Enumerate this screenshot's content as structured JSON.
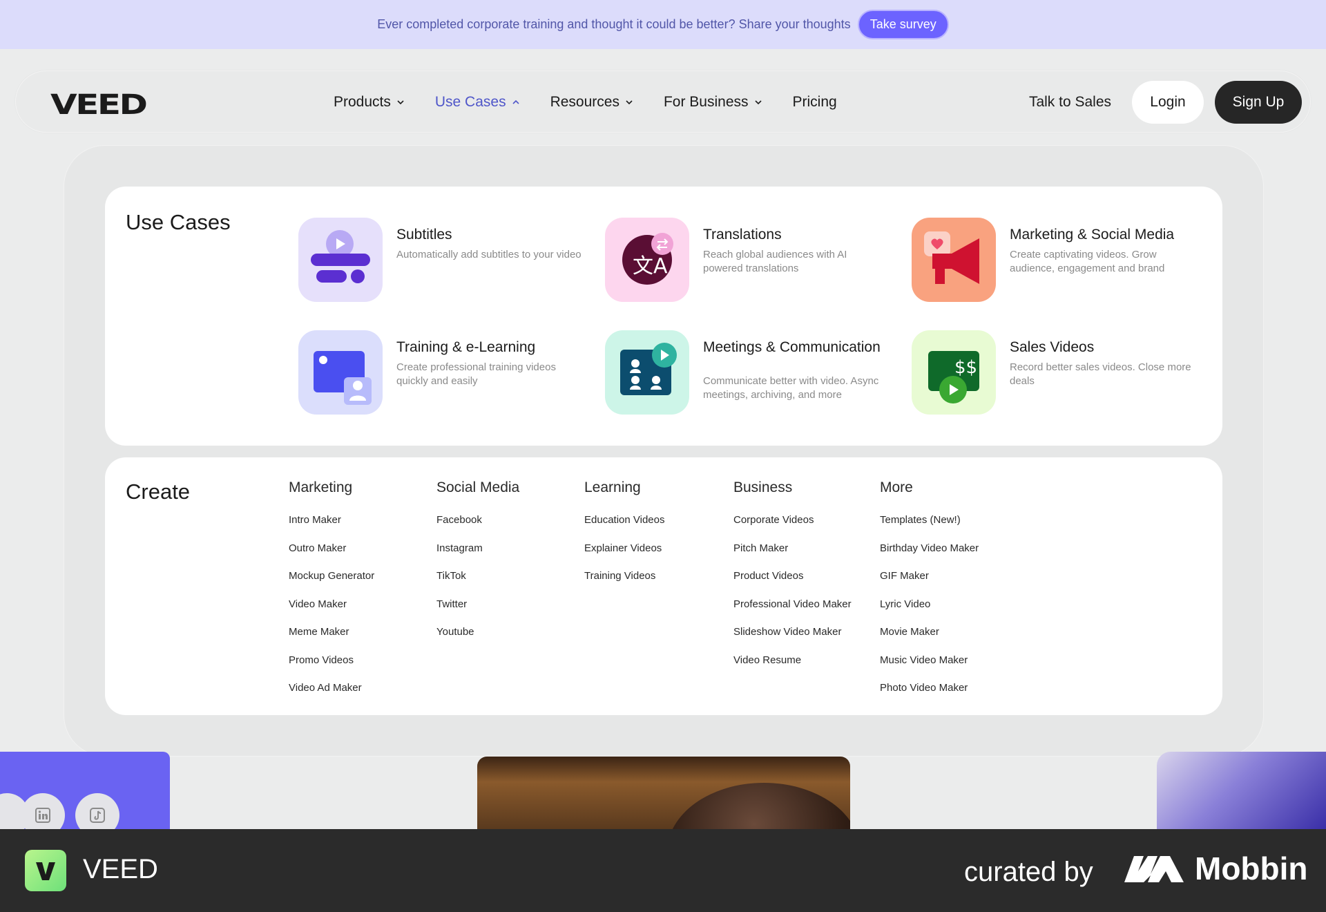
{
  "banner": {
    "text": "Ever completed corporate training and thought it could be better? Share your thoughts",
    "button": "Take survey"
  },
  "nav": {
    "logo": "VEED",
    "items": [
      {
        "label": "Products",
        "has_chevron": true,
        "active": false
      },
      {
        "label": "Use Cases",
        "has_chevron": true,
        "active": true
      },
      {
        "label": "Resources",
        "has_chevron": true,
        "active": false
      },
      {
        "label": "For Business",
        "has_chevron": true,
        "active": false
      },
      {
        "label": "Pricing",
        "has_chevron": false,
        "active": false
      }
    ],
    "talk_to_sales": "Talk to Sales",
    "login": "Login",
    "signup": "Sign Up"
  },
  "use_cases": {
    "title": "Use Cases",
    "items": [
      {
        "name": "Subtitles",
        "desc": "Automatically add subtitles to your video",
        "icon": "subtitles-icon"
      },
      {
        "name": "Translations",
        "desc": "Reach global audiences with AI powered translations",
        "icon": "translate-icon"
      },
      {
        "name": "Marketing & Social Media",
        "desc": "Create captivating videos. Grow audience, engagement and brand",
        "icon": "megaphone-icon"
      },
      {
        "name": "Training & e-Learning",
        "desc": "Create professional training videos quickly and easily",
        "icon": "presentation-icon"
      },
      {
        "name": "Meetings & Communication",
        "desc": "Communicate better with video. Async meetings, archiving, and more",
        "icon": "meeting-icon"
      },
      {
        "name": "Sales Videos",
        "desc": "Record better sales videos. Close more deals",
        "icon": "money-icon"
      }
    ]
  },
  "create": {
    "title": "Create",
    "columns": [
      {
        "heading": "Marketing",
        "links": [
          "Intro Maker",
          "Outro Maker",
          "Mockup Generator",
          "Video Maker",
          "Meme Maker",
          "Promo Videos",
          "Video Ad Maker"
        ]
      },
      {
        "heading": "Social Media",
        "links": [
          "Facebook",
          "Instagram",
          "TikTok",
          "Twitter",
          "Youtube"
        ]
      },
      {
        "heading": "Learning",
        "links": [
          "Education Videos",
          "Explainer Videos",
          "Training Videos"
        ]
      },
      {
        "heading": "Business",
        "links": [
          "Corporate Videos",
          "Pitch Maker",
          "Product Videos",
          "Professional Video Maker",
          "Slideshow Video Maker",
          "Video Resume"
        ]
      },
      {
        "heading": "More",
        "links": [
          "Templates (New!)",
          "Birthday Video Maker",
          "GIF Maker",
          "Lyric Video",
          "Movie Maker",
          "Music Video Maker",
          "Photo Video Maker"
        ]
      }
    ]
  },
  "footer": {
    "brand": "VEED",
    "curated_by": "curated by",
    "mobbin": "Mobbin"
  },
  "colors": {
    "accent": "#4f56c9",
    "banner_bg": "#dcdcfb",
    "survey_button": "#6c63ff",
    "signup_bg": "#262626",
    "footer_bg": "#2b2b2b"
  }
}
